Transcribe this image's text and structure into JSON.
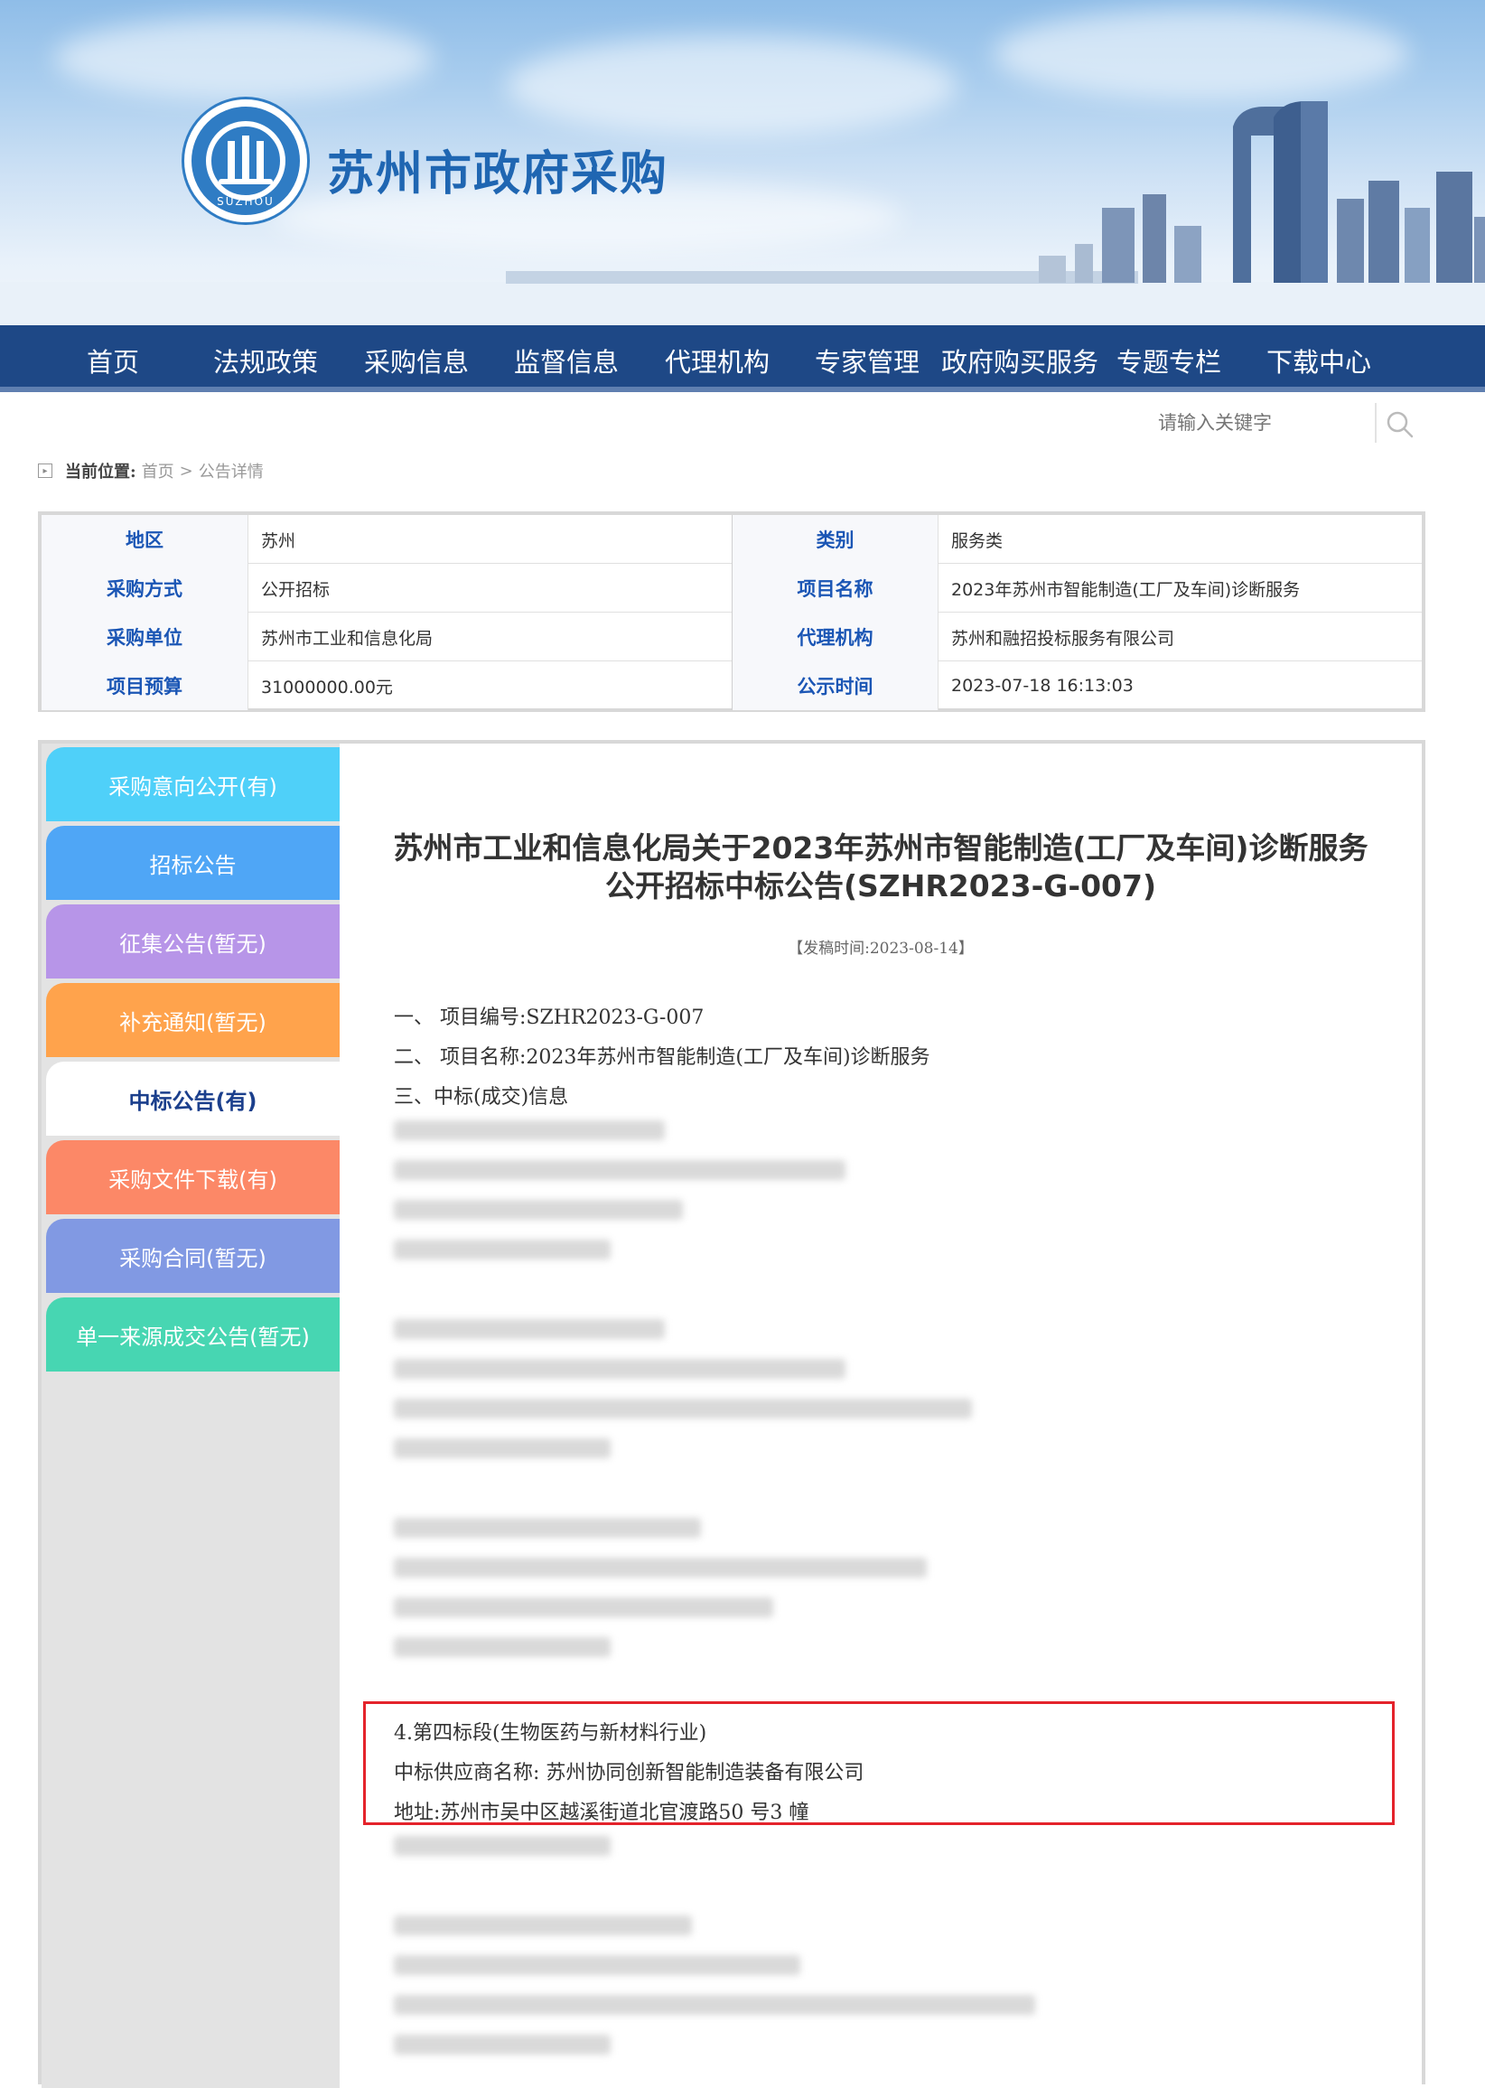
{
  "site": {
    "title": "苏州市政府采购",
    "logo_ring": "SUZHOU"
  },
  "nav": {
    "items": [
      "首页",
      "法规政策",
      "采购信息",
      "监督信息",
      "代理机构",
      "专家管理",
      "政府购买服务",
      "专题专栏",
      "下载中心"
    ]
  },
  "search": {
    "placeholder": "请输入关键字",
    "icon": "magnifier-icon"
  },
  "breadcrumb": {
    "label": "当前位置:",
    "home": "首页",
    "sep": ">",
    "current": "公告详情"
  },
  "info_table": {
    "rows": [
      {
        "l1": "地区",
        "v1": "苏州",
        "l2": "类别",
        "v2": "服务类"
      },
      {
        "l1": "采购方式",
        "v1": "公开招标",
        "l2": "项目名称",
        "v2": "2023年苏州市智能制造(工厂及车间)诊断服务"
      },
      {
        "l1": "采购单位",
        "v1": "苏州市工业和信息化局",
        "l2": "代理机构",
        "v2": "苏州和融招投标服务有限公司"
      },
      {
        "l1": "项目预算",
        "v1": "31000000.00元",
        "l2": "公示时间",
        "v2": "2023-07-18 16:13:03"
      }
    ]
  },
  "sidebar": {
    "items": [
      {
        "label": "采购意向公开(有)",
        "color": "#4fd0f9"
      },
      {
        "label": "招标公告",
        "color": "#4fa6f6"
      },
      {
        "label": "征集公告(暂无)",
        "color": "#b795e8"
      },
      {
        "label": "补充通知(暂无)",
        "color": "#ffa34c"
      },
      {
        "label": "中标公告(有)",
        "color": "#ffffff"
      },
      {
        "label": "采购文件下载(有)",
        "color": "#fc8867"
      },
      {
        "label": "采购合同(暂无)",
        "color": "#8199e3"
      },
      {
        "label": "单一来源成交公告(暂无)",
        "color": "#47d6b2"
      }
    ],
    "active_index": 4
  },
  "article": {
    "title_line1": "苏州市工业和信息化局关于2023年苏州市智能制造(工厂及车间)诊断服务",
    "title_line2": "公开招标中标公告(SZHR2023-G-007)",
    "date": "【发稿时间:2023-08-14】",
    "lines": {
      "l1": "一、  项目编号:SZHR2023-G-007",
      "l2": "二、  项目名称:2023年苏州市智能制造(工厂及车间)诊断服务",
      "l3": "三、中标(成交)信息",
      "s4_title": "4.第四标段(生物医药与新材料行业)",
      "s4_supplier": "中标供应商名称:  苏州协同创新智能制造装备有限公司",
      "s4_address": "地址:苏州市吴中区越溪街道北官渡路50 号3 幢"
    }
  }
}
